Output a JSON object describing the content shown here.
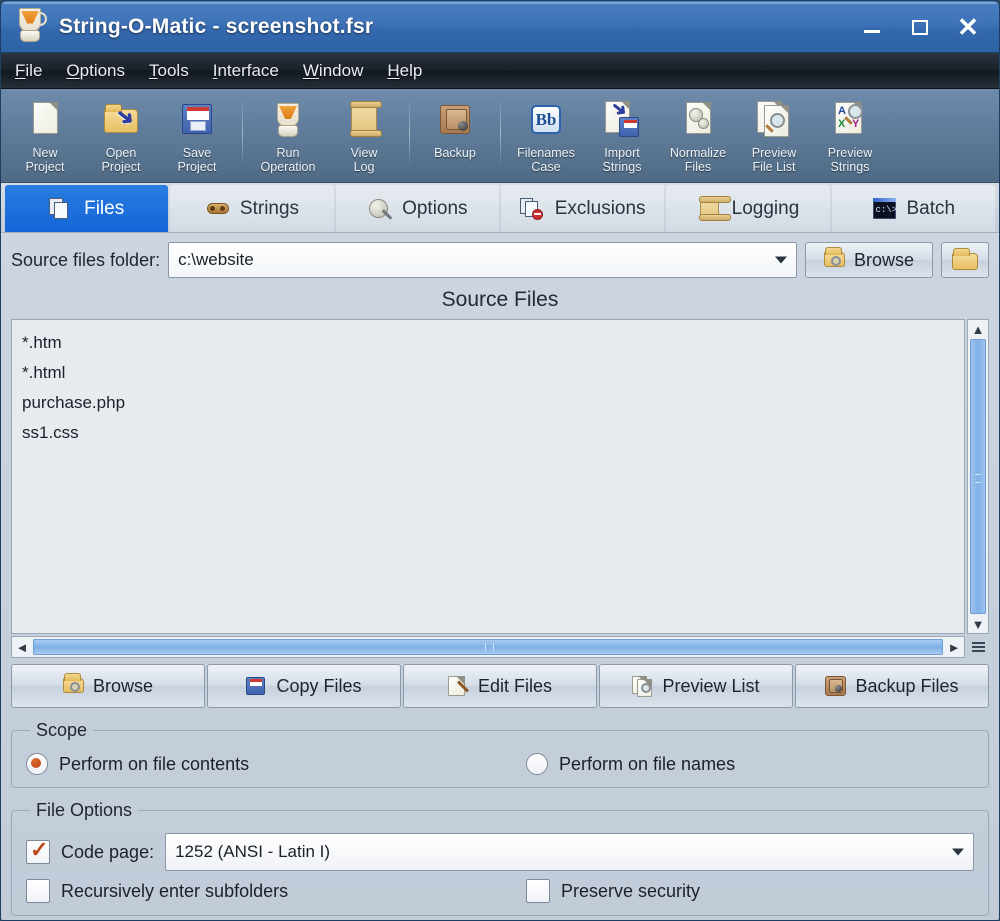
{
  "window": {
    "title": "String-O-Matic - screenshot.fsr",
    "app_icon": "blender-icon",
    "controls": {
      "minimize": "–",
      "maximize": "▢",
      "close": "✕"
    }
  },
  "menubar": {
    "items": [
      {
        "label": "File",
        "mnemonic": "F"
      },
      {
        "label": "Options",
        "mnemonic": "O"
      },
      {
        "label": "Tools",
        "mnemonic": "T"
      },
      {
        "label": "Interface",
        "mnemonic": "I"
      },
      {
        "label": "Window",
        "mnemonic": "W"
      },
      {
        "label": "Help",
        "mnemonic": "H"
      }
    ]
  },
  "toolbar": {
    "buttons": [
      {
        "line1": "New",
        "line2": "Project",
        "icon": "new-document-icon"
      },
      {
        "line1": "Open",
        "line2": "Project",
        "icon": "open-folder-icon"
      },
      {
        "line1": "Save",
        "line2": "Project",
        "icon": "floppy-disk-icon"
      },
      {
        "line1": "Run",
        "line2": "Operation",
        "icon": "blender-run-icon"
      },
      {
        "line1": "View",
        "line2": "Log",
        "icon": "scroll-log-icon"
      },
      {
        "line1": "Backup",
        "line2": "",
        "icon": "safe-backup-icon"
      },
      {
        "line1": "Filenames",
        "line2": "Case",
        "icon": "bb-case-icon"
      },
      {
        "line1": "Import",
        "line2": "Strings",
        "icon": "import-strings-icon"
      },
      {
        "line1": "Normalize",
        "line2": "Files",
        "icon": "gears-document-icon"
      },
      {
        "line1": "Preview",
        "line2": "File List",
        "icon": "preview-filelist-icon"
      },
      {
        "line1": "Preview",
        "line2": "Strings",
        "icon": "preview-strings-icon"
      }
    ],
    "separator_after": [
      4,
      5
    ]
  },
  "tabs": [
    {
      "label": "Files",
      "icon": "files-icon",
      "active": true
    },
    {
      "label": "Strings",
      "icon": "strings-icon",
      "active": false
    },
    {
      "label": "Options",
      "icon": "options-gear-icon",
      "active": false
    },
    {
      "label": "Exclusions",
      "icon": "exclusions-icon",
      "active": false
    },
    {
      "label": "Logging",
      "icon": "logging-scroll-icon",
      "active": false
    },
    {
      "label": "Batch",
      "icon": "batch-console-icon",
      "active": false
    }
  ],
  "source_folder": {
    "label": "Source files folder:",
    "value": "c:\\website",
    "browse_label": "Browse",
    "browse_icon": "folder-search-icon",
    "open_folder_icon": "folder-icon"
  },
  "source_files": {
    "title": "Source Files",
    "items": [
      "*.htm",
      "*.html",
      "purchase.php",
      "ss1.css"
    ]
  },
  "file_buttons": [
    {
      "label": "Browse",
      "icon": "folder-search-icon"
    },
    {
      "label": "Copy Files",
      "icon": "copy-files-icon"
    },
    {
      "label": "Edit Files",
      "icon": "edit-files-icon"
    },
    {
      "label": "Preview List",
      "icon": "preview-list-icon"
    },
    {
      "label": "Backup Files",
      "icon": "safe-backup-icon"
    }
  ],
  "scope": {
    "legend": "Scope",
    "option_contents": "Perform on file contents",
    "option_names": "Perform on file names",
    "selected": "contents"
  },
  "file_options": {
    "legend": "File Options",
    "code_page_label": "Code page:",
    "code_page_checked": true,
    "code_page_value": "1252 (ANSI - Latin I)",
    "recursive_label": "Recursively enter subfolders",
    "recursive_checked": false,
    "preserve_label": "Preserve security",
    "preserve_checked": false
  },
  "colors": {
    "titlebar_blue": "#3569ad",
    "active_tab_blue": "#1565d8",
    "radio_orange": "#c0491e",
    "check_orange": "#bf4a1e",
    "scrollbar_blue": "#7fb0e6"
  }
}
